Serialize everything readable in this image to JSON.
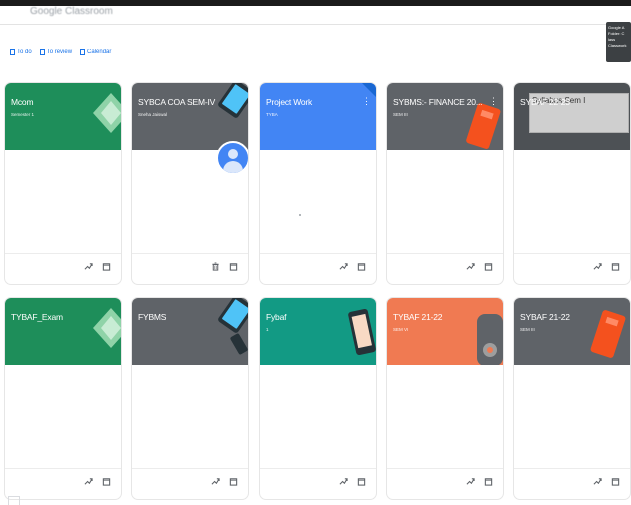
{
  "app": {
    "title": "Google Classroom"
  },
  "tooltip": {
    "lines": [
      "Google A",
      "Folder: C",
      "lass",
      "Classwork"
    ]
  },
  "nav": {
    "todo": "To do",
    "to_review": "To review",
    "calendar": "Calendar"
  },
  "cards": [
    {
      "title": "Mcom",
      "subtitle": "Semester 1",
      "color": "#1e8e5a",
      "illus": "diamond"
    },
    {
      "title": "SYBCA COA SEM-IV",
      "subtitle": "Sneha Jaiswal",
      "color": "#5f6368",
      "illus": "tablet",
      "avatar": true
    },
    {
      "title": "Project Work",
      "subtitle": "TYBA",
      "color": "#4285f4",
      "illus": "corner"
    },
    {
      "title": "SYBMS:- FINANCE 20...",
      "subtitle": "SEM III",
      "color": "#5f6368",
      "illus": "book"
    },
    {
      "title": "SYBAF 22-23",
      "subtitle": "",
      "color": "#4d5155",
      "illus": "paper",
      "overlay": "Syllabus Sem I"
    },
    {
      "title": "TYBAF_Exam",
      "subtitle": "",
      "color": "#1e8e5a",
      "illus": "diamond"
    },
    {
      "title": "FYBMS",
      "subtitle": "",
      "color": "#5f6368",
      "illus": "tablet"
    },
    {
      "title": "Fybaf",
      "subtitle": "1",
      "color": "#129a84",
      "illus": "phone"
    },
    {
      "title": "TYBAF 21-22",
      "subtitle": "SEM VI",
      "color": "#f07a52",
      "illus": "gadget"
    },
    {
      "title": "SYBAF 21-22",
      "subtitle": "SEM III",
      "color": "#5f6368",
      "illus": "book"
    }
  ],
  "icons": {
    "trend": "trending-up-icon",
    "folder": "folder-icon",
    "trash": "trash-icon",
    "more": "more-vert-icon"
  }
}
